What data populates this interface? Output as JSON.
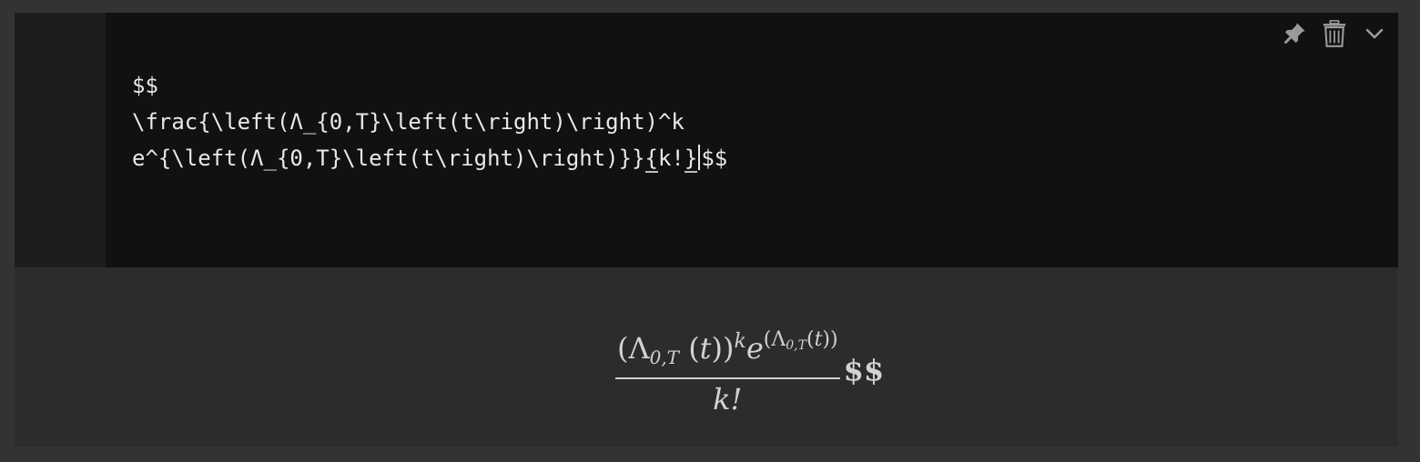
{
  "editor": {
    "lines": [
      "$$",
      "\\frac{\\left(Λ_{0,T}\\left(t\\right)\\right)^k",
      "e^{\\left(Λ_{0,T}\\left(t\\right)\\right)}}"
    ],
    "line3_open_brace": "{",
    "line3_mid": "k!",
    "line3_close_brace": "}",
    "line3_tail": "$$"
  },
  "toolbar": {
    "icons": [
      "pin-icon",
      "trash-icon",
      "chevron-down-icon"
    ]
  },
  "preview": {
    "numerator": {
      "open": "(Λ",
      "sub": "0,T",
      "mid": " (",
      "var": "t",
      "close": "))",
      "sup": "k",
      "e": "e",
      "exp_open": "(Λ",
      "exp_sub": "0,T",
      "exp_mid": "(",
      "exp_var": "t",
      "exp_close": "))"
    },
    "denominator": "k!",
    "trailing": "$$"
  },
  "colors": {
    "background": "#333333",
    "editor_bg": "#111111",
    "gutter_bg": "#1d1d1d",
    "preview_bg": "#2c2c2c",
    "text": "#e8e8e8",
    "math": "#d2d2d2",
    "icon": "#9a9a9a"
  }
}
